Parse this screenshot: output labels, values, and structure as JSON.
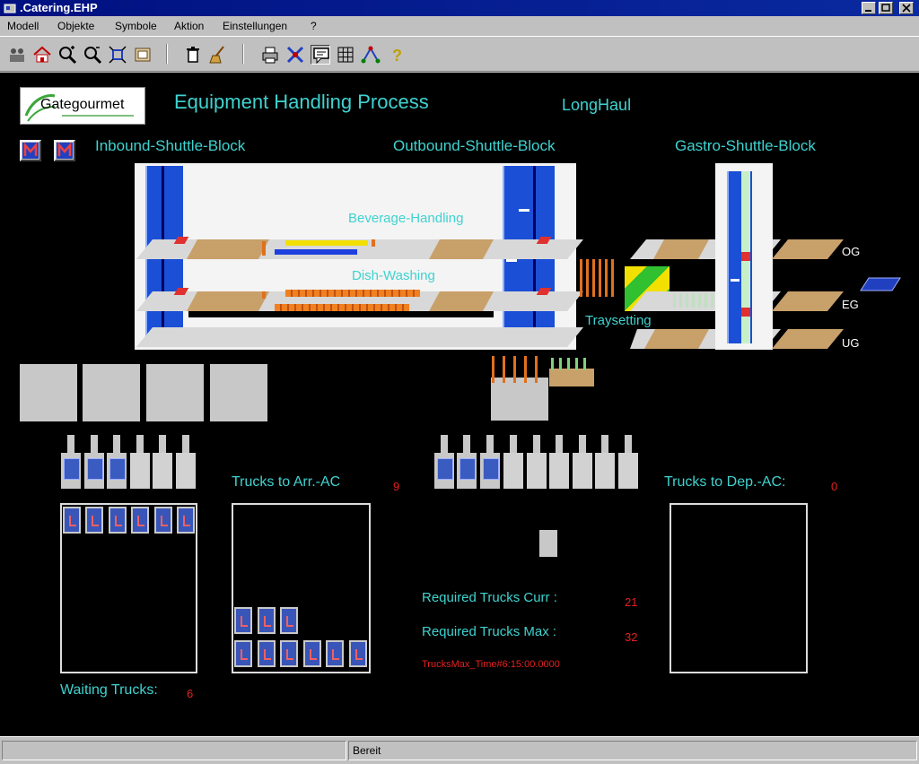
{
  "window": {
    "title": ".Catering.EHP"
  },
  "menu": {
    "items": [
      "Modell",
      "Objekte",
      "Symbole",
      "Aktion",
      "Einstellungen",
      "?"
    ]
  },
  "header": {
    "logo_text": "Gategourmet",
    "title": "Equipment Handling Process",
    "mode": "LongHaul"
  },
  "blocks": {
    "inbound": "Inbound-Shuttle-Block",
    "outbound": "Outbound-Shuttle-Block",
    "gastro": "Gastro-Shuttle-Block"
  },
  "processes": {
    "beverage": "Beverage-Handling",
    "dish": "Dish-Washing",
    "tray": "Traysetting"
  },
  "levels": [
    "OG",
    "EG",
    "UG"
  ],
  "trucks": {
    "arr_label": "Trucks to Arr.-AC",
    "arr_value": "9",
    "dep_label": "Trucks to Dep.-AC:",
    "dep_value": "0",
    "waiting_label": "Waiting Trucks:",
    "waiting_value": "6",
    "required_curr_label": "Required Trucks Curr :",
    "required_curr_value": "21",
    "required_max_label": "Required Trucks Max :",
    "required_max_value": "32",
    "max_time": "TrucksMax_Time#6:15:00.0000"
  },
  "status": {
    "text": "Bereit"
  },
  "colors": {
    "cyan": "#3fd3d0",
    "red": "#e52020",
    "rack_blue": "#1b4fd6",
    "canvas_bg": "#000000"
  }
}
